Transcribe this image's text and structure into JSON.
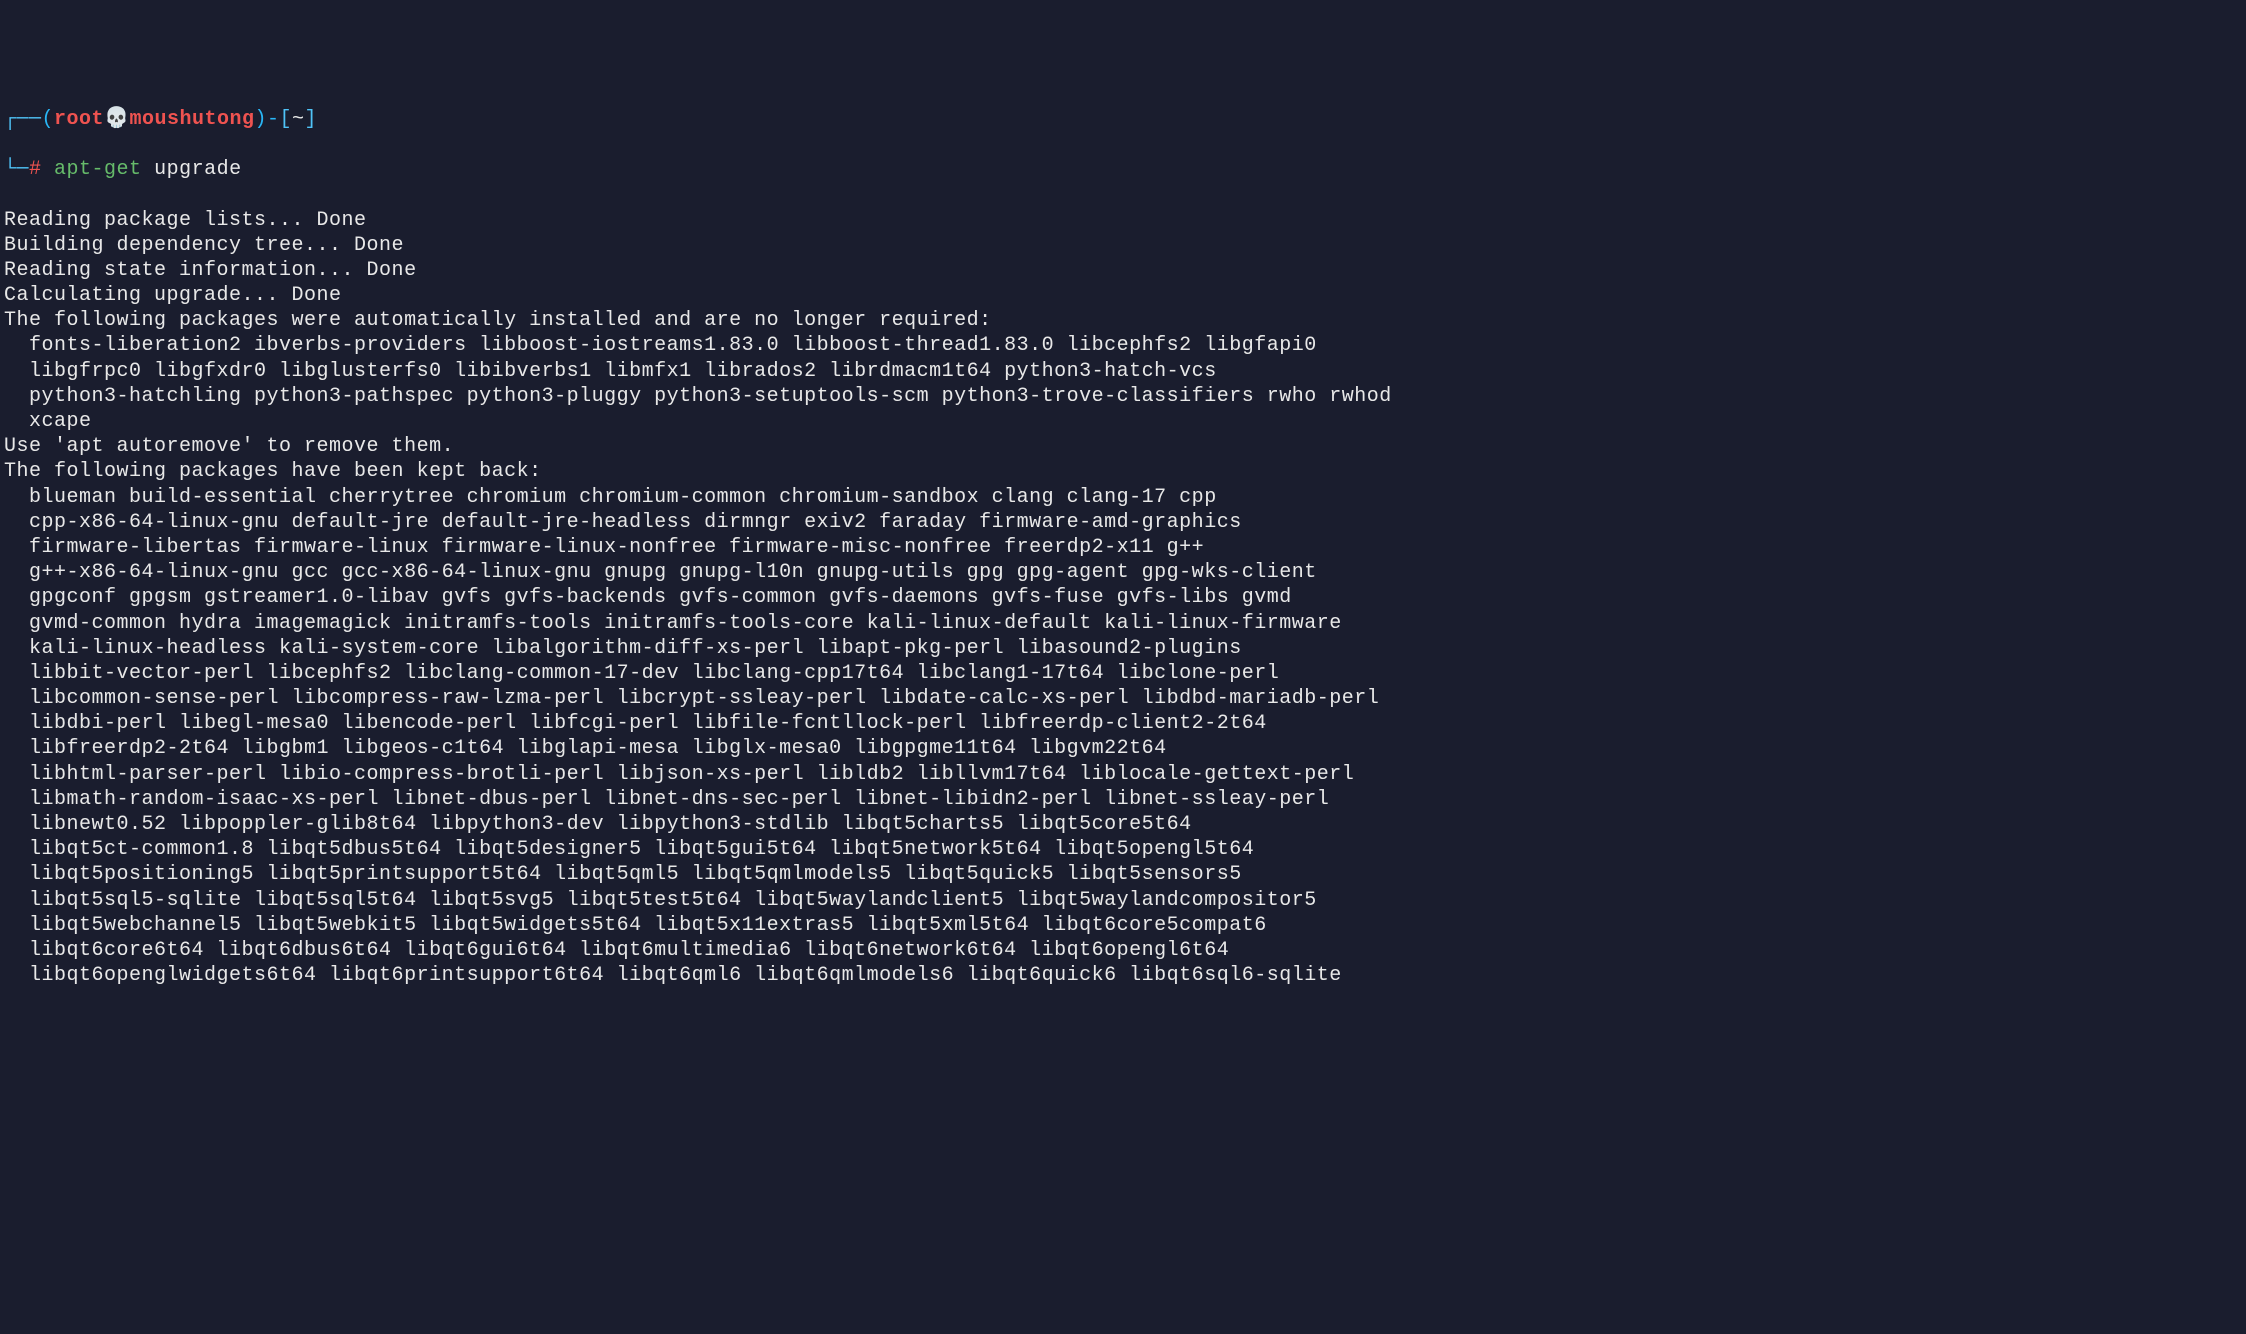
{
  "prompt": {
    "corner_top": "┌──",
    "paren_open": "(",
    "user": "root",
    "skull": "💀",
    "host": "moushutong",
    "paren_close": ")",
    "dash": "-",
    "bracket_open": "[",
    "tilde": "~",
    "bracket_close": "]",
    "corner_bottom": "└─",
    "hash": "#",
    "command": "apt-get",
    "arg": "upgrade"
  },
  "lines": {
    "l1": "Reading package lists... Done",
    "l2": "Building dependency tree... Done",
    "l3": "Reading state information... Done",
    "l4": "Calculating upgrade... Done",
    "l5": "The following packages were automatically installed and are no longer required:",
    "l6": "  fonts-liberation2 ibverbs-providers libboost-iostreams1.83.0 libboost-thread1.83.0 libcephfs2 libgfapi0",
    "l7": "  libgfrpc0 libgfxdr0 libglusterfs0 libibverbs1 libmfx1 librados2 librdmacm1t64 python3-hatch-vcs",
    "l8": "  python3-hatchling python3-pathspec python3-pluggy python3-setuptools-scm python3-trove-classifiers rwho rwhod",
    "l9": "  xcape",
    "l10": "Use 'apt autoremove' to remove them.",
    "l11": "The following packages have been kept back:",
    "l12": "  blueman build-essential cherrytree chromium chromium-common chromium-sandbox clang clang-17 cpp",
    "l13": "  cpp-x86-64-linux-gnu default-jre default-jre-headless dirmngr exiv2 faraday firmware-amd-graphics",
    "l14": "  firmware-libertas firmware-linux firmware-linux-nonfree firmware-misc-nonfree freerdp2-x11 g++",
    "l15": "  g++-x86-64-linux-gnu gcc gcc-x86-64-linux-gnu gnupg gnupg-l10n gnupg-utils gpg gpg-agent gpg-wks-client",
    "l16": "  gpgconf gpgsm gstreamer1.0-libav gvfs gvfs-backends gvfs-common gvfs-daemons gvfs-fuse gvfs-libs gvmd",
    "l17": "  gvmd-common hydra imagemagick initramfs-tools initramfs-tools-core kali-linux-default kali-linux-firmware",
    "l18": "  kali-linux-headless kali-system-core libalgorithm-diff-xs-perl libapt-pkg-perl libasound2-plugins",
    "l19": "  libbit-vector-perl libcephfs2 libclang-common-17-dev libclang-cpp17t64 libclang1-17t64 libclone-perl",
    "l20": "  libcommon-sense-perl libcompress-raw-lzma-perl libcrypt-ssleay-perl libdate-calc-xs-perl libdbd-mariadb-perl",
    "l21": "  libdbi-perl libegl-mesa0 libencode-perl libfcgi-perl libfile-fcntllock-perl libfreerdp-client2-2t64",
    "l22": "  libfreerdp2-2t64 libgbm1 libgeos-c1t64 libglapi-mesa libglx-mesa0 libgpgme11t64 libgvm22t64",
    "l23": "  libhtml-parser-perl libio-compress-brotli-perl libjson-xs-perl libldb2 libllvm17t64 liblocale-gettext-perl",
    "l24": "  libmath-random-isaac-xs-perl libnet-dbus-perl libnet-dns-sec-perl libnet-libidn2-perl libnet-ssleay-perl",
    "l25": "  libnewt0.52 libpoppler-glib8t64 libpython3-dev libpython3-stdlib libqt5charts5 libqt5core5t64",
    "l26": "  libqt5ct-common1.8 libqt5dbus5t64 libqt5designer5 libqt5gui5t64 libqt5network5t64 libqt5opengl5t64",
    "l27": "  libqt5positioning5 libqt5printsupport5t64 libqt5qml5 libqt5qmlmodels5 libqt5quick5 libqt5sensors5",
    "l28": "  libqt5sql5-sqlite libqt5sql5t64 libqt5svg5 libqt5test5t64 libqt5waylandclient5 libqt5waylandcompositor5",
    "l29": "  libqt5webchannel5 libqt5webkit5 libqt5widgets5t64 libqt5x11extras5 libqt5xml5t64 libqt6core5compat6",
    "l30": "  libqt6core6t64 libqt6dbus6t64 libqt6gui6t64 libqt6multimedia6 libqt6network6t64 libqt6opengl6t64",
    "l31": "  libqt6openglwidgets6t64 libqt6printsupport6t64 libqt6qml6 libqt6qmlmodels6 libqt6quick6 libqt6sql6-sqlite"
  }
}
